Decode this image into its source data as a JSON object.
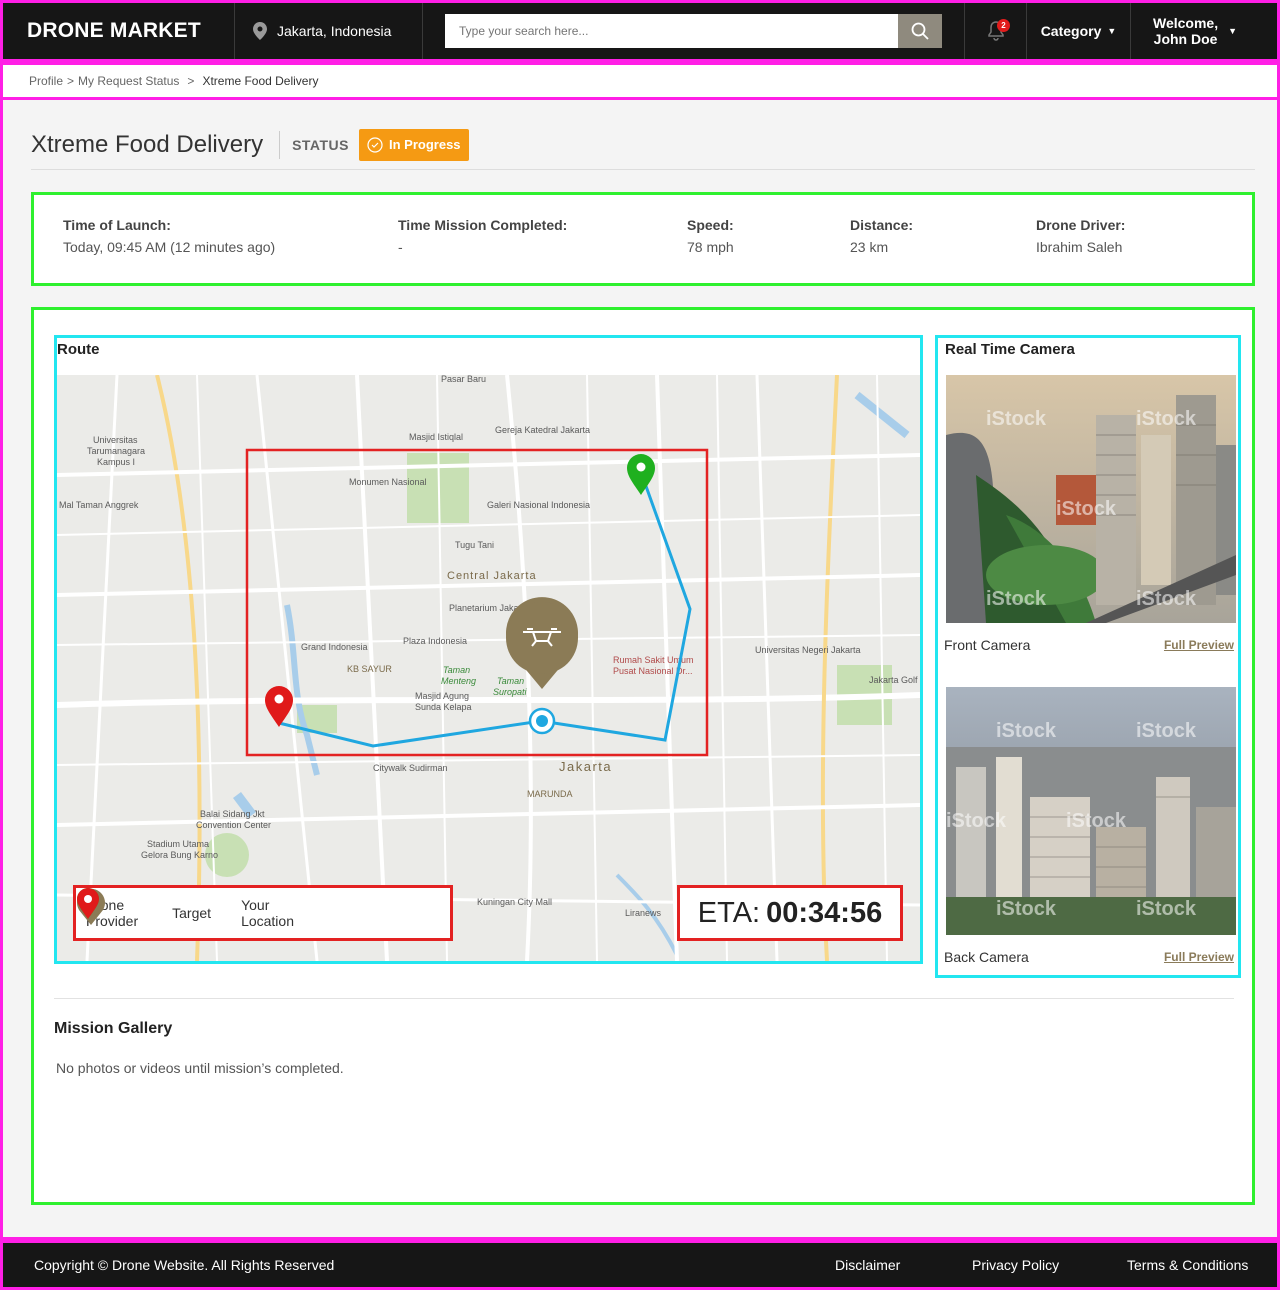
{
  "header": {
    "logo": "DRONE MARKET",
    "location": "Jakarta, Indonesia",
    "search_placeholder": "Type your search here...",
    "notification_count": "2",
    "category_label": "Category",
    "welcome_line1": "Welcome,",
    "welcome_line2": "John Doe"
  },
  "breadcrumb": {
    "items": [
      "Profile",
      "My Request Status",
      "Xtreme Food Delivery"
    ],
    "separator": ">"
  },
  "page": {
    "title": "Xtreme Food Delivery",
    "status_label": "STATUS",
    "status_value": "In Progress",
    "status_color": "#f59a13"
  },
  "info": [
    {
      "label": "Time of Launch:",
      "value": "Today, 09:45 AM (12 minutes ago)"
    },
    {
      "label": "Time Mission Completed:",
      "value": "-"
    },
    {
      "label": "Speed:",
      "value": "78 mph"
    },
    {
      "label": "Distance:",
      "value": "23 km"
    },
    {
      "label": "Drone Driver:",
      "value": "Ibrahim Saleh"
    }
  ],
  "route": {
    "title": "Route",
    "map_labels": {
      "monumen": "Monumen Nasional",
      "galeri": "Galeri Nasional Indonesia",
      "tugu": "Tugu Tani",
      "central": "Central Jakarta",
      "planetarium": "Planetarium Jakarta",
      "plaza": "Plaza Indonesia",
      "grand": "Grand Indonesia",
      "kbsayur": "KB SAYUR",
      "masjid_agung": "Masjid Agung",
      "sunda": "Sunda Kelapa",
      "rumah_sakit1": "Rumah Sakit Umum",
      "rumah_sakit2": "Pusat Nasional Dr...",
      "jakarta": "Jakarta",
      "marunda": "MARUNDA",
      "citywalk": "Citywalk Sudirman",
      "balai1": "Balai Sidang Jkt",
      "balai2": "Convention Center",
      "stadium1": "Stadium Utama",
      "stadium2": "Gelora Bung Karno",
      "kuningan": "Kuningan City Mall",
      "pasar": "Pasar Baru",
      "istiqlal": "Masjid Istiqlal",
      "gereja": "Gereja Katedral Jakarta",
      "univ1": "Universitas",
      "univ2": "Tarumanagara",
      "univ3": "Kampus I",
      "taman_anggrek": "Mal Taman Anggrek",
      "unj": "Universitas Negeri Jakarta",
      "jakarta_golf": "Jakarta Golf",
      "taman_menteng1": "Taman",
      "taman_menteng2": "Menteng",
      "taman_suropati1": "Taman",
      "taman_suropati2": "Suropati",
      "liranews": "Liranews"
    },
    "legend": [
      {
        "label_line1": "Drone",
        "label_line2": "Provider",
        "color": "#8b7b56"
      },
      {
        "label_line1": "Target",
        "label_line2": "",
        "color": "#1fb01f"
      },
      {
        "label_line1": "Your",
        "label_line2": "Location",
        "color": "#e01a1a"
      }
    ],
    "eta_label": "ETA:",
    "eta_value": "00:34:56"
  },
  "camera": {
    "title": "Real Time Camera",
    "front_caption": "Front Camera",
    "back_caption": "Back Camera",
    "preview_link": "Full Preview",
    "watermark": "iStock"
  },
  "gallery": {
    "title": "Mission Gallery",
    "text": "No photos or videos until mission’s completed."
  },
  "footer": {
    "copyright": "Copyright © Drone Website. All Rights Reserved",
    "links": [
      "Disclaimer",
      "Privacy Policy",
      "Terms & Conditions"
    ]
  }
}
